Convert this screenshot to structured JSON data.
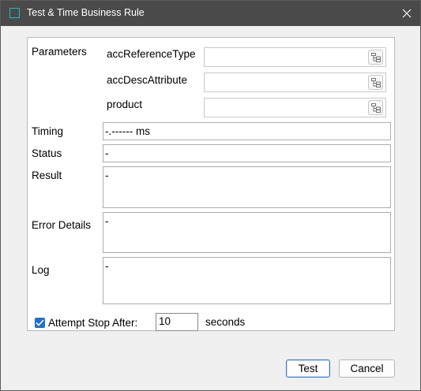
{
  "window": {
    "title": "Test & Time Business Rule",
    "accent": "#2bb6c9",
    "titlebar_color": "#4a4a4a"
  },
  "parameters": {
    "section_label": "Parameters",
    "items": [
      {
        "label": "accReferenceType",
        "value": ""
      },
      {
        "label": "accDescAttribute",
        "value": ""
      },
      {
        "label": "product",
        "value": ""
      }
    ]
  },
  "timing": {
    "label": "Timing",
    "value": "-.------ ms"
  },
  "status": {
    "label": "Status",
    "value": "-"
  },
  "result": {
    "label": "Result",
    "value": "-"
  },
  "error_details": {
    "label": "Error Details",
    "value": "-"
  },
  "log": {
    "label": "Log",
    "value": "-"
  },
  "attempt_stop": {
    "checked": true,
    "label": "Attempt Stop After:",
    "value": "10",
    "unit": "seconds"
  },
  "buttons": {
    "test": "Test",
    "cancel": "Cancel"
  }
}
